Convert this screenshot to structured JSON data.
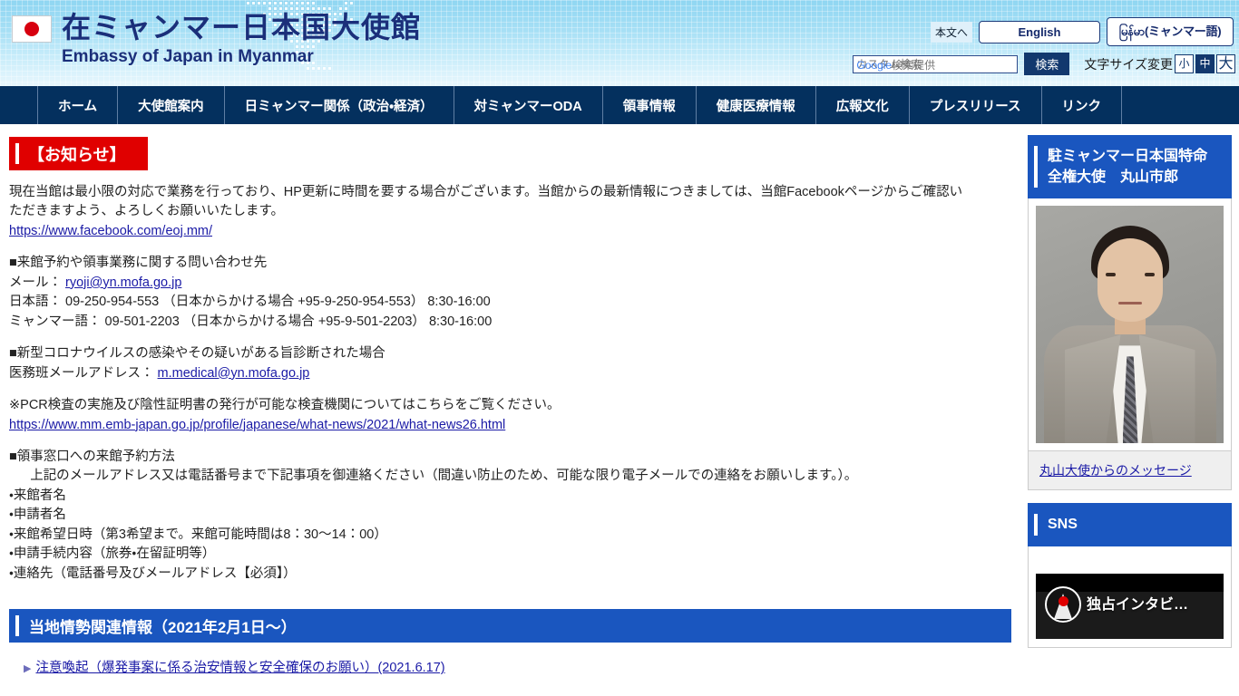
{
  "header": {
    "flag_icon": "japan-flag-icon",
    "site_title": "在ミャンマー日本国大使館",
    "site_subtitle": "Embassy of Japan in Myanmar",
    "skip_link": "本文へ",
    "lang_english": "English",
    "lang_myanmar": "မြန်မာ(ミャンマー語)",
    "search": {
      "value": "",
      "placeholder": "カスタム検索",
      "ghost_google": "Google",
      "ghost_suffix": "検索提供",
      "button_label": "検索"
    },
    "fontsize": {
      "label": "文字サイズ変更",
      "small": "小",
      "medium": "中",
      "large": "大",
      "selected": "中"
    }
  },
  "nav": {
    "items": [
      {
        "label": "ホーム"
      },
      {
        "label": "大使館案内"
      },
      {
        "label": "日ミャンマー関係（政治・経済）"
      },
      {
        "label": "対ミャンマーODA"
      },
      {
        "label": "領事情報"
      },
      {
        "label": "健康医療情報"
      },
      {
        "label": "広報文化"
      },
      {
        "label": "プレスリリース"
      },
      {
        "label": "リンク"
      }
    ]
  },
  "main": {
    "notice_badge": "【お知らせ】",
    "intro_line1": "現在当館は最小限の対応で業務を行っており、HP更新に時間を要する場合がございます。当館からの最新情報につきましては、当館Facebookページからご確認い",
    "intro_line2": "ただきますよう、よろしくお願いいたします。",
    "facebook_url": "https://www.facebook.com/eoj.mm/",
    "contact_heading": "■来館予約や領事業務に関する問い合わせ先",
    "contact_mail_label": "メール：",
    "contact_mail": "ryoji@yn.mofa.go.jp",
    "contact_jp": "日本語： 09-250-954-553 （日本からかける場合 +95-9-250-954-553） 8:30-16:00",
    "contact_mm": "ミャンマー語： 09-501-2203 （日本からかける場合 +95-9-501-2203）  8:30-16:00",
    "covid_heading": "■新型コロナウイルスの感染やその疑いがある旨診断された場合",
    "covid_mail_label": "医務班メールアドレス：",
    "covid_mail": "m.medical@yn.mofa.go.jp",
    "pcr_note": "※PCR検査の実施及び陰性証明書の発行が可能な検査機関についてはこちらをご覧ください。",
    "pcr_url": "https://www.mm.emb-japan.go.jp/profile/japanese/what-news/2021/what-news26.html",
    "reserve_heading": "■領事窓口への来館予約方法",
    "reserve_desc": "上記のメールアドレス又は電話番号まで下記事項を御連絡ください（間違い防止のため、可能な限り電子メールでの連絡をお願いします。）。",
    "reserve_items": [
      "・来館者名",
      "・申請者名",
      "・来館希望日時（第3希望まで。来館可能時間は8：30〜14：00）",
      "・申請手続内容（旅券・在留証明等）",
      "・連絡先（電話番号及びメールアドレス【必須】）"
    ],
    "section_title": "当地情勢関連情報（2021年2月1日〜）",
    "link_items": [
      "注意喚起（爆発事案に係る治安情報と安全確保のお願い）(2021.6.17)"
    ]
  },
  "aside": {
    "ambassador_heading": "駐ミャンマー日本国特命全権大使　丸山市郎",
    "ambassador_photo": "ambassador-portrait",
    "ambassador_link": "丸山大使からのメッセージ",
    "sns_heading": "SNS",
    "video_title": "独占インタビ…"
  },
  "colors": {
    "nav_bg": "#04305e",
    "notice_red": "#e00000",
    "section_blue": "#1a56bf",
    "link_blue": "#1a1aa6",
    "header_gradient_top": "#8fd6f2"
  }
}
